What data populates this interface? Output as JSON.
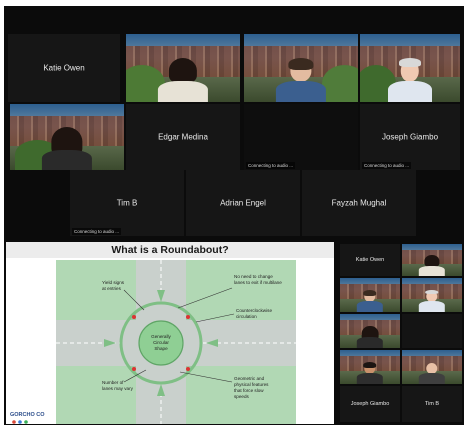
{
  "gallery": {
    "katie_owen": "Katie Owen",
    "edgar_medina": "Edgar Medina",
    "joseph_giambo": "Joseph Giambo",
    "tim_b": "Tim B",
    "adrian_engel": "Adrian Engel",
    "fayzah_mughal": "Fayzah Mughal",
    "connecting_audio": "Connecting to audio ..."
  },
  "slide": {
    "title": "What is a Roundabout?",
    "labels": {
      "yield_1": "Yield signs",
      "yield_2": "at entries",
      "nochange_1": "No need to change",
      "nochange_2": "lanes to exit if multilane",
      "counter_1": "Counterclockwise",
      "counter_2": "circulation",
      "island_1": "Generally",
      "island_2": "Circular",
      "island_3": "Shape",
      "lanes_1": "Number of",
      "lanes_2": "lanes may vary",
      "geo_1": "Geometric and",
      "geo_2": "physical features",
      "geo_3": "that force slow",
      "geo_4": "speeds"
    },
    "logo_text": "GORCHO CO"
  },
  "side_panel": {
    "katie_owen": "Katie Owen",
    "joseph_giambo": "Joseph Giambo",
    "tim_b": "Tim B"
  },
  "colors": {
    "active_outline": "#d8d65a",
    "road": "#c9d0cc",
    "grass": "#7fbf85",
    "island": "#8fcf94"
  }
}
